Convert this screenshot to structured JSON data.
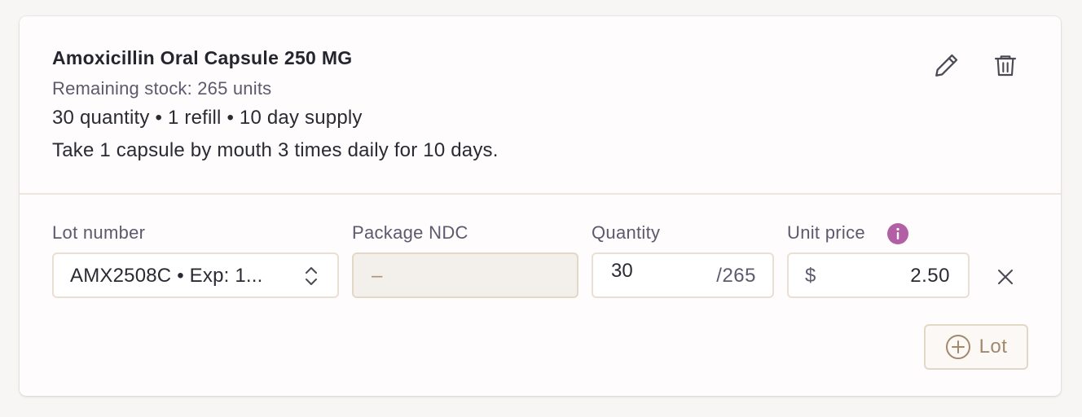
{
  "medication": {
    "name": "Amoxicillin Oral Capsule 250 MG",
    "stock": "Remaining stock: 265 units",
    "summary": "30 quantity • 1 refill • 10 day supply",
    "sig": "Take 1 capsule by mouth 3 times daily for 10 days."
  },
  "icons": {
    "edit": "pencil-icon",
    "delete": "trash-icon",
    "info": "info-icon",
    "chevron": "chevron-up-down-icon",
    "remove": "close-icon",
    "add": "plus-circle-icon"
  },
  "form": {
    "lot_label": "Lot number",
    "lot_value": "AMX2508C • Exp: 1...",
    "ndc_label": "Package NDC",
    "ndc_value": "–",
    "qty_label": "Quantity",
    "qty_value": "30",
    "qty_max": "/265",
    "price_label": "Unit price",
    "currency": "$",
    "price_value": "2.50"
  },
  "actions": {
    "add_lot_label": "Lot"
  },
  "colors": {
    "info_badge": "#b25fa5",
    "accent_tan": "#a08a6b",
    "border": "#e8e0d4"
  }
}
